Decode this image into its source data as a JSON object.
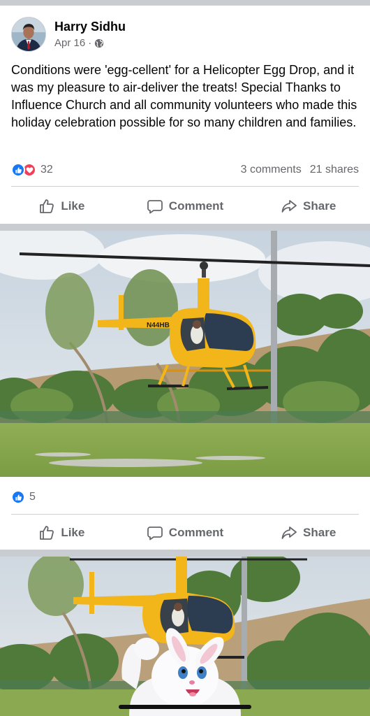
{
  "post": {
    "author": "Harry Sidhu",
    "date": "Apr 16",
    "date_separator": "·",
    "visibility_icon": "globe-icon",
    "text": "Conditions were 'egg-cellent' for a Helicopter Egg Drop, and it was my pleasure to air-deliver the treats! Special Thanks to Influence Church and all community volunteers who made this holiday celebration possible for so many children and families.",
    "reaction_icons": [
      "like-reaction-icon",
      "love-reaction-icon"
    ],
    "reaction_count": "32",
    "comments": "3 comments",
    "shares": "21 shares"
  },
  "actions": {
    "like": "Like",
    "comment": "Comment",
    "share": "Share"
  },
  "photo1": {
    "reaction_icons": [
      "like-reaction-icon"
    ],
    "reaction_count": "5",
    "helicopter_tail_text": "N44HB"
  },
  "colors": {
    "facebook_blue": "#1877f2",
    "love_red": "#f33e58",
    "secondary_text": "#65676b",
    "helicopter_yellow": "#f2b51a"
  }
}
